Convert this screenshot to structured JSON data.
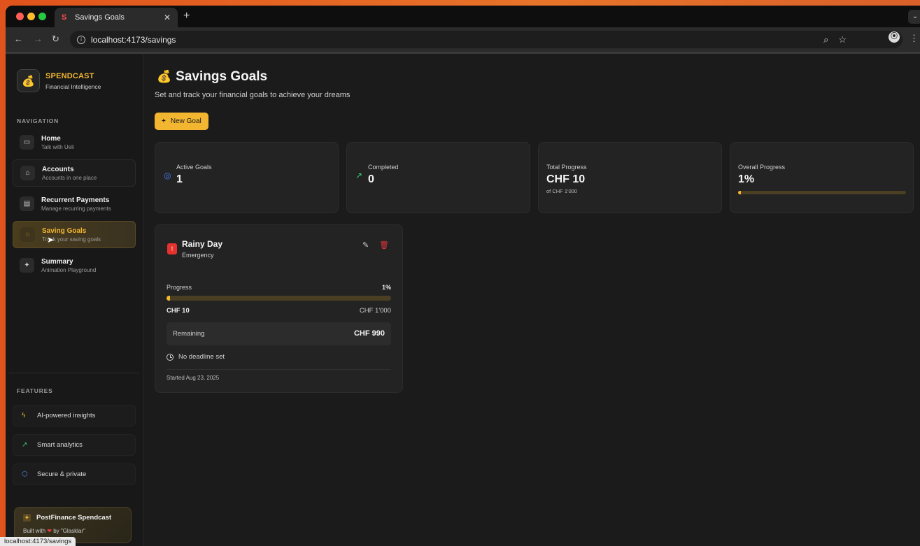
{
  "browser": {
    "tab_title": "Savings Goals",
    "url": "localhost:4173/savings",
    "status_url": "localhost:4173/savings"
  },
  "brand": {
    "name": "SPENDCAST",
    "tagline": "Financial Intelligence",
    "logo_emoji": "💰"
  },
  "sidebar": {
    "nav_label": "NAVIGATION",
    "items": [
      {
        "title": "Home",
        "subtitle": "Talk with Ueli",
        "icon": "chat-icon"
      },
      {
        "title": "Accounts",
        "subtitle": "Accounts in one place",
        "icon": "home-icon"
      },
      {
        "title": "Recurrent Payments",
        "subtitle": "Manage recurring payments",
        "icon": "card-icon"
      },
      {
        "title": "Saving Goals",
        "subtitle": "Track your saving goals",
        "icon": "piggy-bank-icon",
        "active": true
      },
      {
        "title": "Summary",
        "subtitle": "Animation Playground",
        "icon": "sparkles-icon"
      }
    ],
    "features_label": "FEATURES",
    "features": [
      {
        "label": "AI-powered insights",
        "icon": "lightning-icon"
      },
      {
        "label": "Smart analytics",
        "icon": "trending-up-icon"
      },
      {
        "label": "Secure & private",
        "icon": "shield-icon"
      }
    ],
    "footer": {
      "title": "PostFinance Spendcast",
      "built_prefix": "Built with",
      "built_suffix": "by \"Glasklar\""
    }
  },
  "main": {
    "title": "Savings Goals",
    "title_emoji": "💰",
    "subtitle": "Set and track your financial goals to achieve your dreams",
    "new_goal_label": "New Goal",
    "stats": [
      {
        "label": "Active Goals",
        "value": "1",
        "icon": "target-icon"
      },
      {
        "label": "Completed",
        "value": "0",
        "icon": "trending-up-icon"
      },
      {
        "label": "Total Progress",
        "value": "CHF 10",
        "note": "of CHF 1'000"
      },
      {
        "label": "Overall Progress",
        "value": "1%",
        "progress": 0.01
      }
    ],
    "goal": {
      "name": "Rainy Day",
      "category": "Emergency",
      "progress_label": "Progress",
      "progress_pct": "1%",
      "progress": 0.01,
      "current": "CHF 10",
      "target": "CHF 1'000",
      "remaining_label": "Remaining",
      "remaining_value": "CHF 990",
      "deadline": "No deadline set",
      "started": "Started Aug 23, 2025"
    }
  },
  "colors": {
    "accent": "#f2b630",
    "danger": "#e0343b",
    "background": "#1b1b1b"
  }
}
